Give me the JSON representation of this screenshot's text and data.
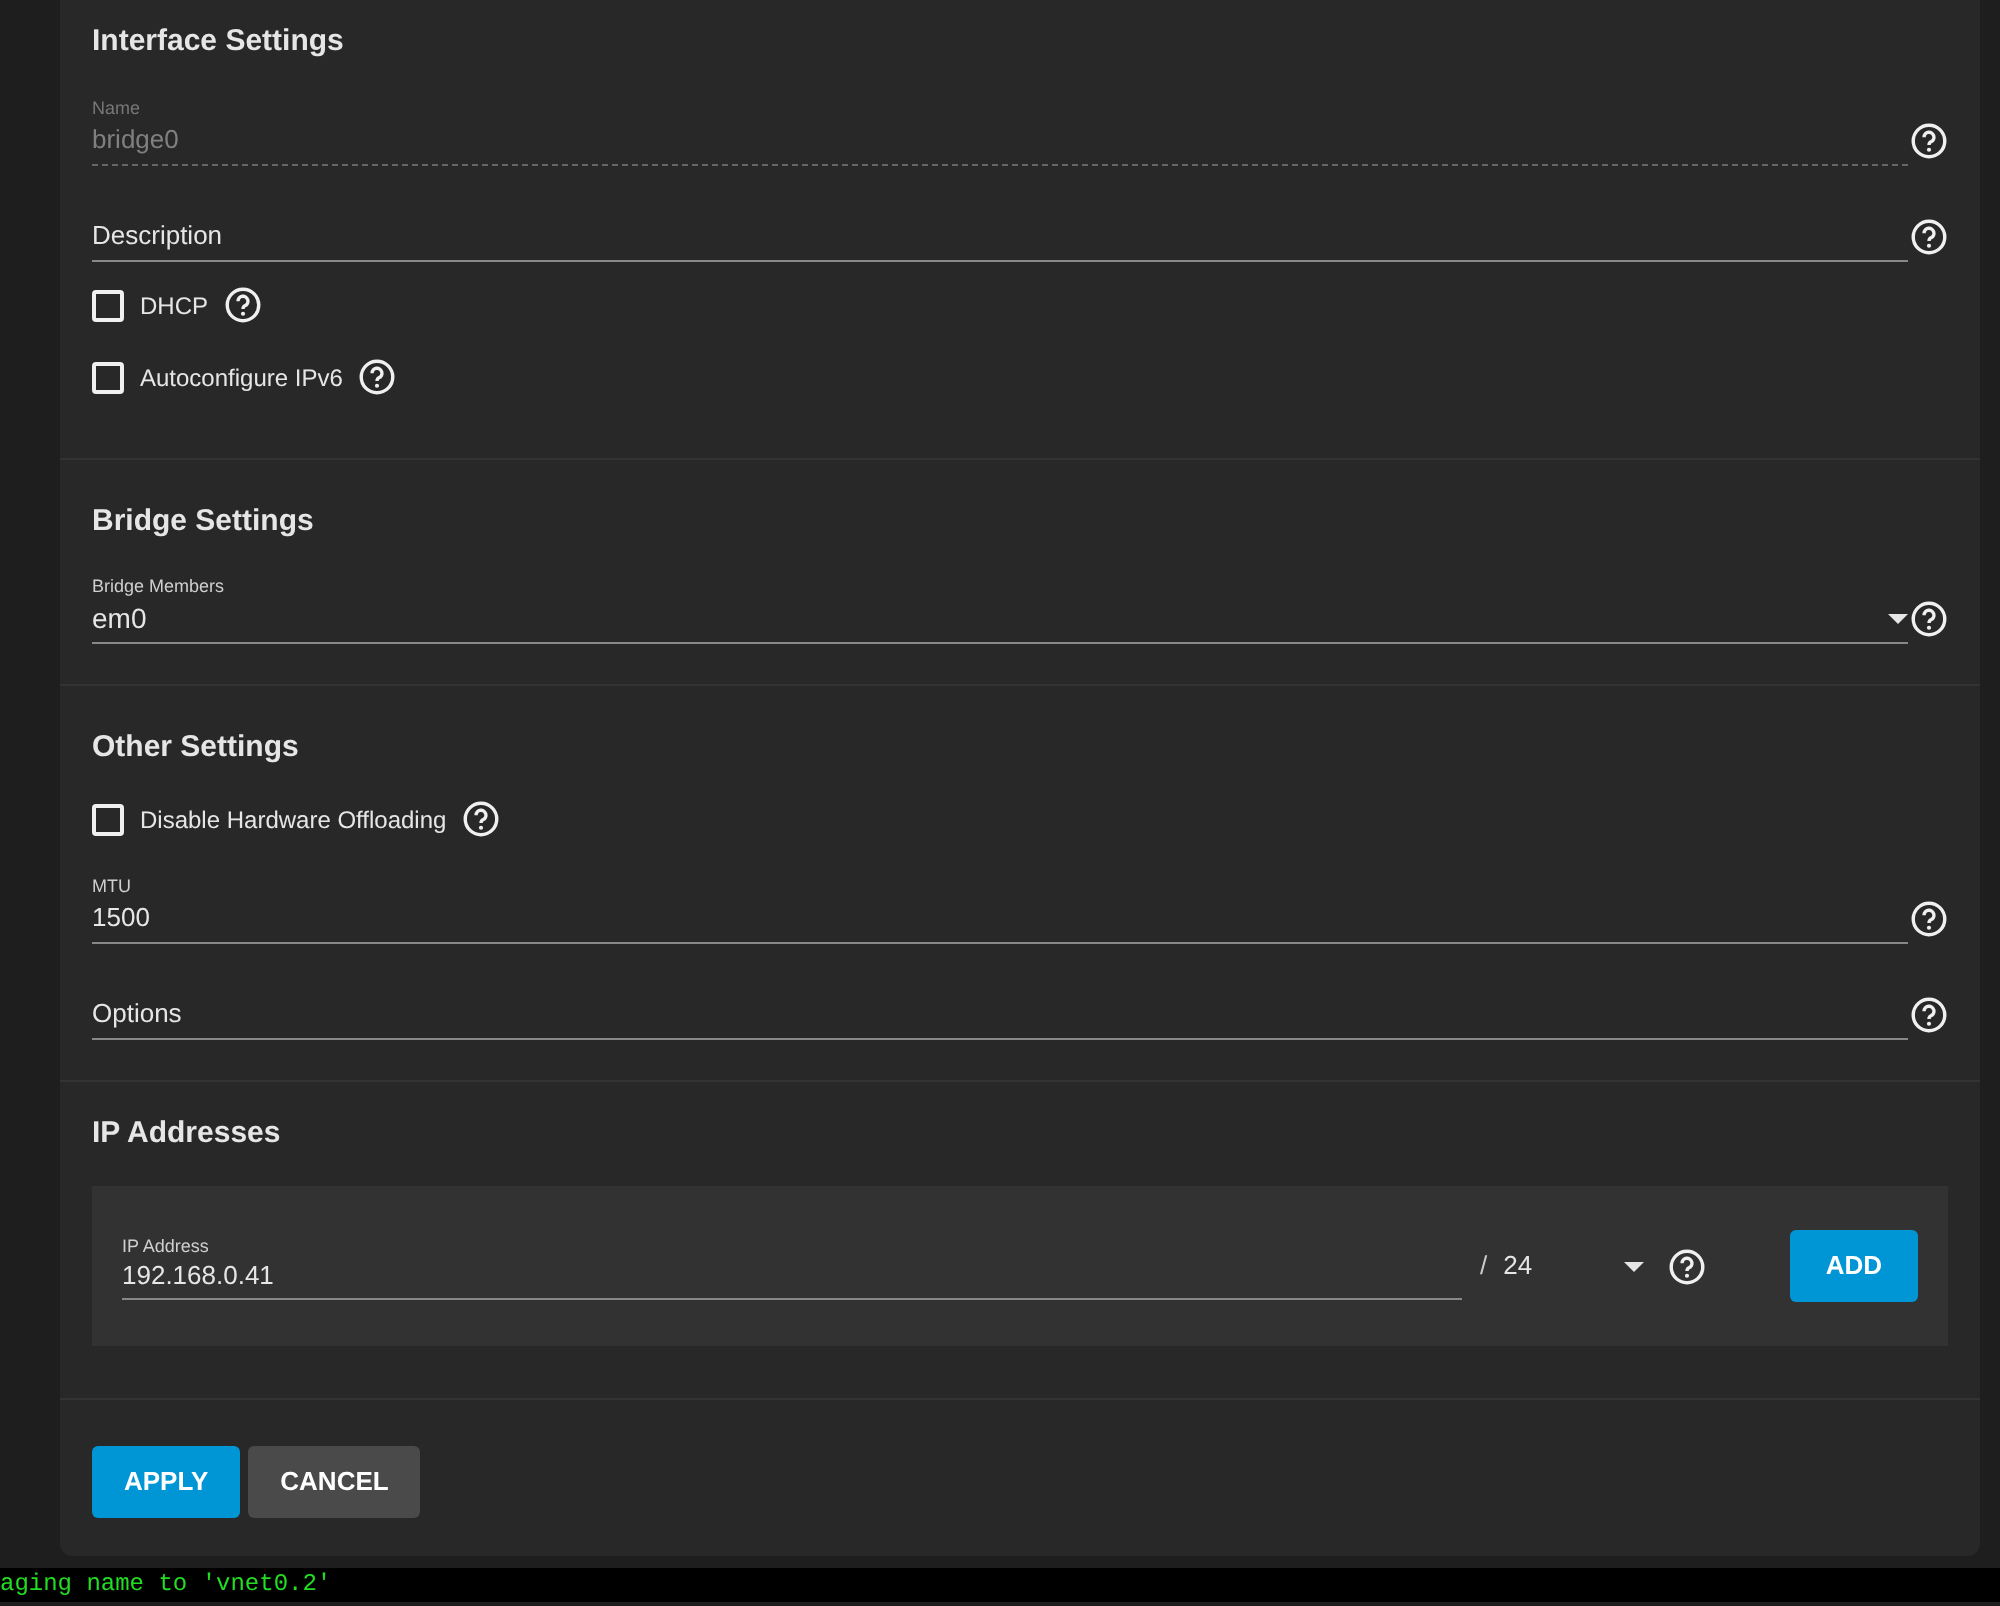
{
  "sections": [
    {
      "title": "Interface Settings",
      "items": [
        {
          "kind": "field",
          "label": "Name",
          "value": "bridge0",
          "disabled": true
        },
        {
          "kind": "field",
          "placeholder": "Description",
          "disabled": false
        },
        {
          "kind": "checkbox",
          "label": "DHCP",
          "checked": false
        },
        {
          "kind": "checkbox",
          "label": "Autoconfigure IPv6",
          "checked": false
        }
      ]
    },
    {
      "title": "Bridge Settings",
      "items": [
        {
          "kind": "select",
          "label": "Bridge Members",
          "value": "em0"
        }
      ]
    },
    {
      "title": "Other Settings",
      "items": [
        {
          "kind": "checkbox",
          "label": "Disable Hardware Offloading",
          "checked": false
        },
        {
          "kind": "field",
          "label": "MTU",
          "value": "1500",
          "disabled": false
        },
        {
          "kind": "field",
          "placeholder": "Options",
          "disabled": false
        }
      ]
    }
  ],
  "ip_addresses": {
    "title": "IP Addresses",
    "entries": [
      {
        "label": "IP Address",
        "value": "192.168.0.41",
        "separator": "/",
        "netmask": "24",
        "button": "ADD"
      }
    ]
  },
  "buttons": [
    {
      "label": "APPLY",
      "kind": "primary"
    },
    {
      "label": "CANCEL",
      "kind": "secondary"
    }
  ],
  "console_line": "aging name to 'vnet0.2'"
}
